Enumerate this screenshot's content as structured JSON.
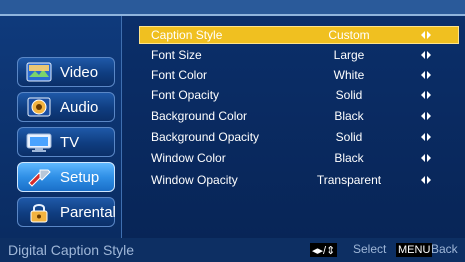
{
  "menu": [
    {
      "label": "Video",
      "icon": "video-icon",
      "active": false
    },
    {
      "label": "Audio",
      "icon": "audio-icon",
      "active": false
    },
    {
      "label": "TV",
      "icon": "tv-icon",
      "active": false
    },
    {
      "label": "Setup",
      "icon": "setup-icon",
      "active": true
    },
    {
      "label": "Parental",
      "icon": "parental-icon",
      "active": false
    }
  ],
  "settings": [
    {
      "label": "Caption Style",
      "value": "Custom",
      "selected": true
    },
    {
      "label": "Font Size",
      "value": "Large",
      "selected": false
    },
    {
      "label": "Font Color",
      "value": "White",
      "selected": false
    },
    {
      "label": "Font Opacity",
      "value": "Solid",
      "selected": false
    },
    {
      "label": "Background Color",
      "value": "Black",
      "selected": false
    },
    {
      "label": "Background Opacity",
      "value": "Solid",
      "selected": false
    },
    {
      "label": "Window Color",
      "value": "Black",
      "selected": false
    },
    {
      "label": "Window Opacity",
      "value": "Transparent",
      "selected": false
    }
  ],
  "bottom": {
    "title": "Digital Caption Style",
    "select_keys": "◂▸/⇕",
    "select_label": "Select",
    "menu_key": "MENU",
    "back_label": "Back"
  },
  "colors": {
    "selection": "#f0c020",
    "accent": "#f0c020"
  }
}
